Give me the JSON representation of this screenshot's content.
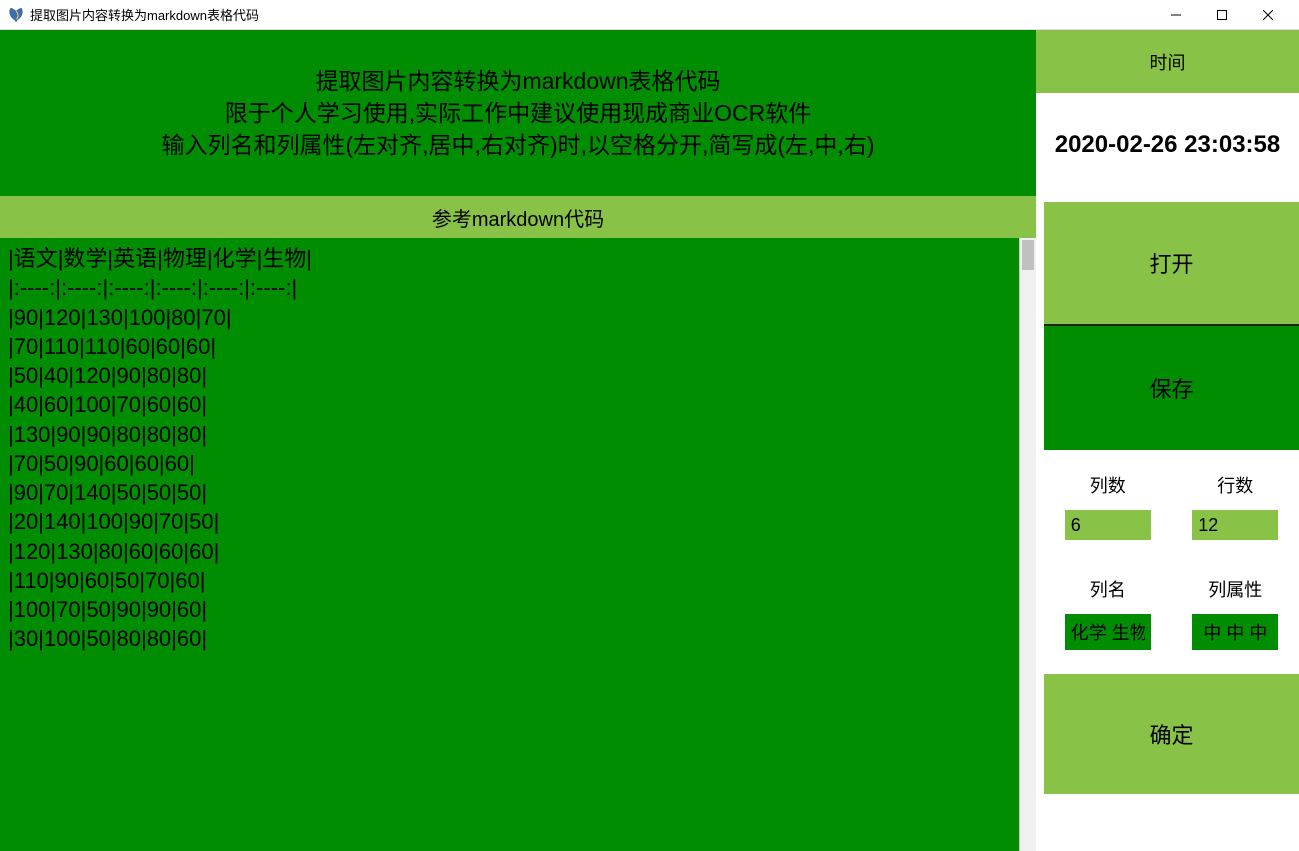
{
  "window": {
    "title": "提取图片内容转换为markdown表格代码"
  },
  "header": {
    "line1": "提取图片内容转换为markdown表格代码",
    "line2": "限于个人学习使用,实际工作中建议使用现成商业OCR软件",
    "line3": "输入列名和列属性(左对齐,居中,右对齐)时,以空格分开,简写成(左,中,右)"
  },
  "time": {
    "label": "时间",
    "value": "2020-02-26 23:03:58"
  },
  "subheader": "参考markdown代码",
  "code": "|语文|数学|英语|物理|化学|生物|\n|:----:|:----:|:----:|:----:|:----:|:----:|\n|90|120|130|100|80|70|\n|70|110|110|60|60|60|\n|50|40|120|90|80|80|\n|40|60|100|70|60|60|\n|130|90|90|80|80|80|\n|70|50|90|60|60|60|\n|90|70|140|50|50|50|\n|20|140|100|90|70|50|\n|120|130|80|60|60|60|\n|110|90|60|50|70|60|\n|100|70|50|90|90|60|\n|30|100|50|80|80|60|",
  "buttons": {
    "open": "打开",
    "save": "保存",
    "confirm": "确定"
  },
  "form": {
    "cols_label": "列数",
    "rows_label": "行数",
    "cols_value": "6",
    "rows_value": "12",
    "names_label": "列名",
    "attrs_label": "列属性",
    "names_value": "化学 生物",
    "attrs_value": "中 中 中"
  }
}
